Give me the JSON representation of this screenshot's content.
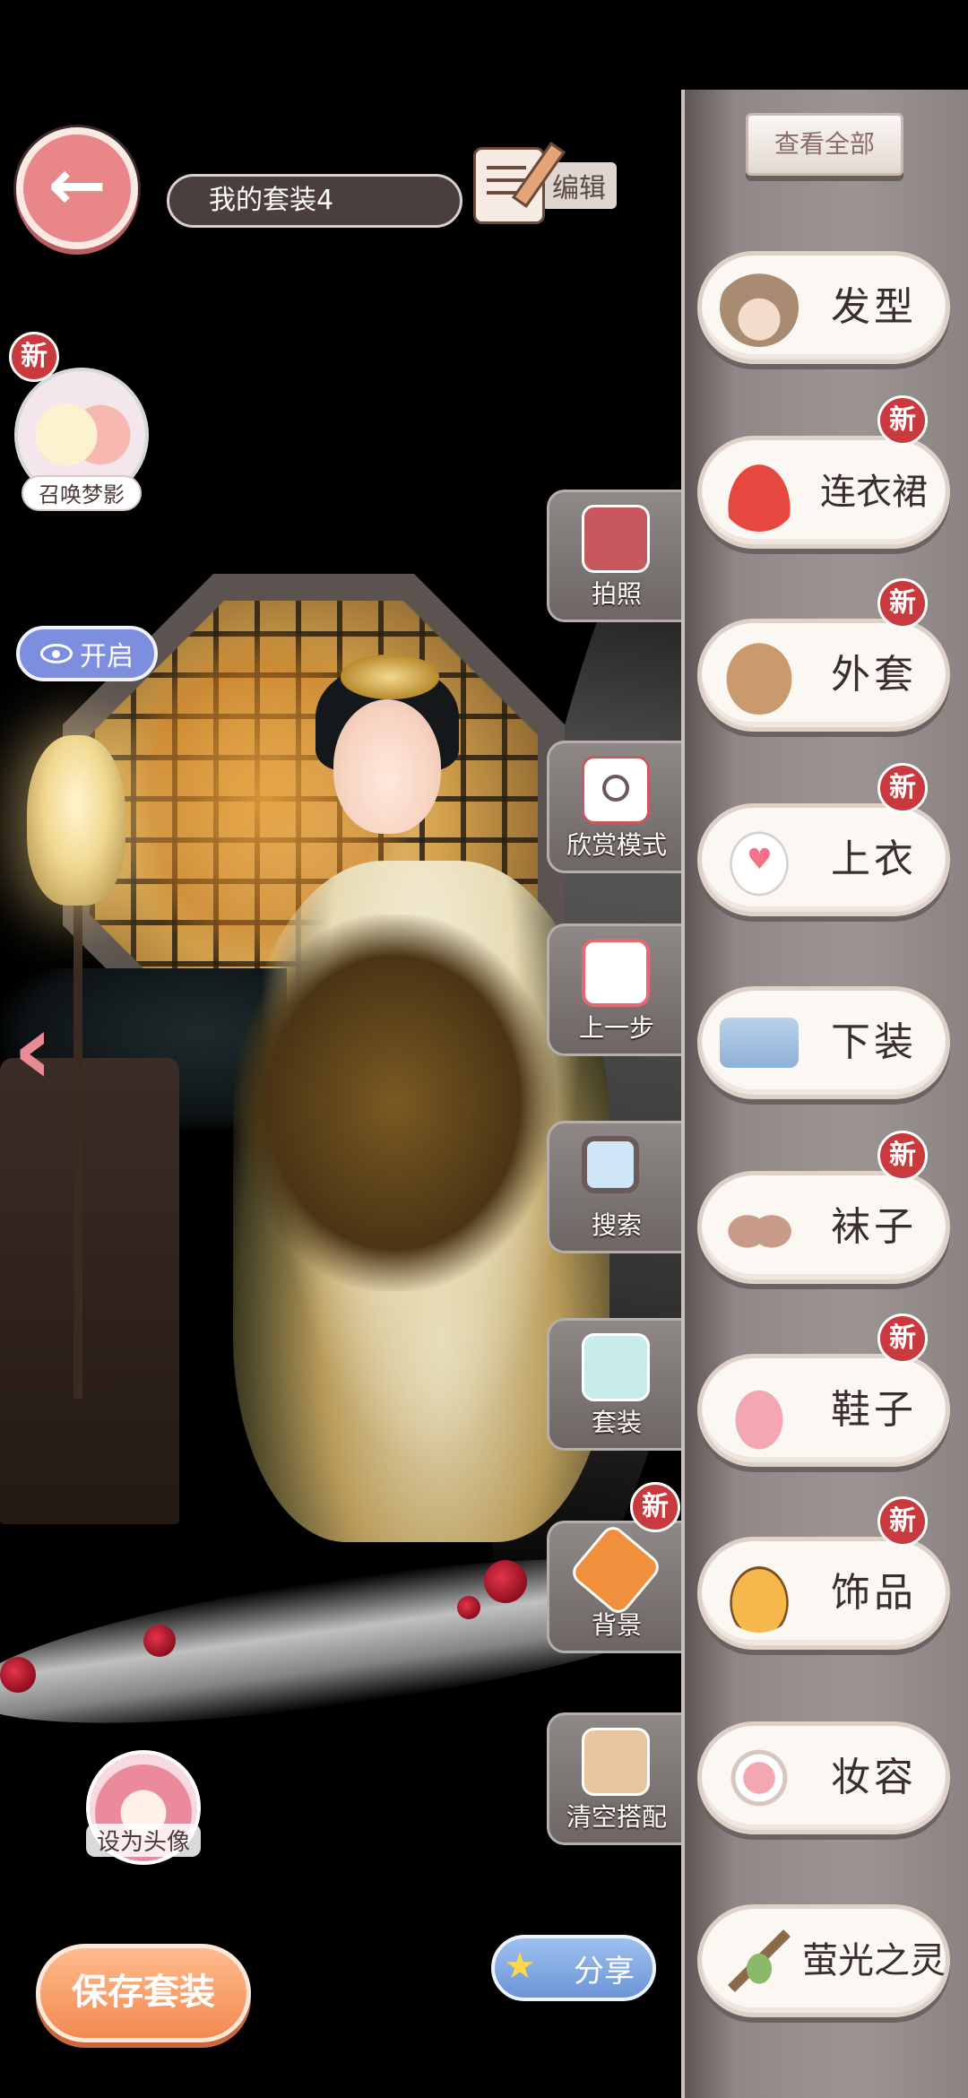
{
  "header": {
    "outfit_name": "我的套装4",
    "edit_label": "编辑"
  },
  "left": {
    "summon_badge": "新",
    "summon_label": "召唤梦影",
    "toggle_label": "开启",
    "set_avatar_label": "设为头像",
    "save_label": "保存套装",
    "share_label": "分享"
  },
  "tools": [
    {
      "label": "拍照",
      "icon": "album-icon"
    },
    {
      "label": "欣赏模式",
      "icon": "camera-icon"
    },
    {
      "label": "上一步",
      "icon": "undo-icon"
    },
    {
      "label": "搜索",
      "icon": "search-icon"
    },
    {
      "label": "套装",
      "icon": "suit-icon"
    },
    {
      "label": "背景",
      "icon": "brush-icon",
      "badge": "新"
    },
    {
      "label": "清空搭配",
      "icon": "clear-outfit-icon"
    }
  ],
  "panel": {
    "view_all": "查看全部",
    "categories": [
      {
        "label": "发型",
        "icon": "hair-icon",
        "badge": ""
      },
      {
        "label": "连衣裙",
        "icon": "dress-icon",
        "badge": "新"
      },
      {
        "label": "外套",
        "icon": "coat-icon",
        "badge": "新"
      },
      {
        "label": "上衣",
        "icon": "shirt-icon",
        "badge": "新"
      },
      {
        "label": "下装",
        "icon": "pants-icon",
        "badge": ""
      },
      {
        "label": "袜子",
        "icon": "socks-icon",
        "badge": "新"
      },
      {
        "label": "鞋子",
        "icon": "shoes-icon",
        "badge": "新"
      },
      {
        "label": "饰品",
        "icon": "hat-icon",
        "badge": "新"
      },
      {
        "label": "妆容",
        "icon": "makeup-icon",
        "badge": ""
      },
      {
        "label": "萤光之灵",
        "icon": "sprite-icon",
        "badge": ""
      }
    ]
  },
  "colors": {
    "accent_pink": "#e8868a",
    "badge_red": "#c93a3f",
    "save_orange": "#f28a52",
    "toggle_blue": "#7d8ede"
  }
}
